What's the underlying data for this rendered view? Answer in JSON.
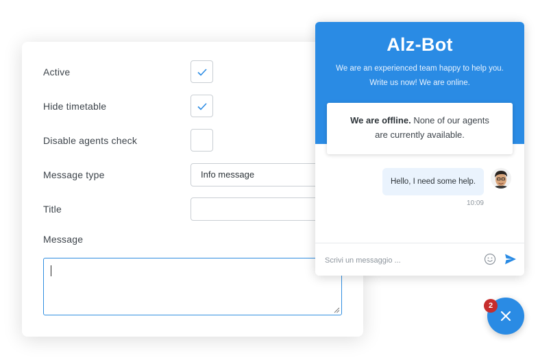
{
  "settings": {
    "active_label": "Active",
    "active_checked": true,
    "hide_timetable_label": "Hide timetable",
    "hide_timetable_checked": true,
    "disable_agents_check_label": "Disable agents check",
    "disable_agents_check_checked": false,
    "message_type_label": "Message type",
    "message_type_value": "Info message",
    "title_label": "Title",
    "title_value": "",
    "message_label": "Message",
    "message_value": ""
  },
  "chat": {
    "title": "Alz-Bot",
    "subtitle_line1": "We are an experienced team happy to help you.",
    "subtitle_line2": "Write us now! We are online.",
    "offline_bold": "We are offline.",
    "offline_text_1": " None of our agents",
    "offline_text_2": "are currently available.",
    "message_text": "Hello, I need some help.",
    "message_time": "10:09",
    "input_placeholder": "Scrivi un messaggio ..."
  },
  "launcher": {
    "badge_count": "2"
  },
  "icons": {
    "checkmark": "check-icon",
    "emoji": "emoji-icon",
    "send": "send-icon",
    "close": "close-icon"
  },
  "colors": {
    "accent": "#2a8be4",
    "badge": "#c62d2d",
    "bubble": "#eaf3fd"
  }
}
